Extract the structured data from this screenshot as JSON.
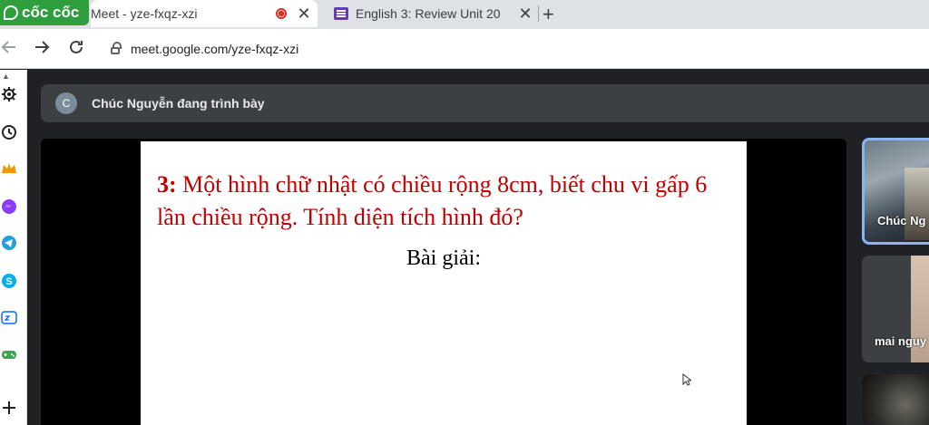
{
  "browser": {
    "brand": "cốc cốc",
    "tabs": [
      {
        "title": "Meet - yze-fxqz-xzi",
        "active": true,
        "recording": true
      },
      {
        "title": "English 3: Review Unit 20",
        "active": false
      }
    ],
    "close_glyph": "✕",
    "newtab_glyph": "+",
    "url": "meet.google.com/yze-fxqz-xzi"
  },
  "icons": {
    "back": "arrow-left-icon",
    "forward": "arrow-right-icon",
    "reload": "reload-icon",
    "lock": "lock-icon"
  },
  "sidebar": {
    "items": [
      "settings-icon",
      "history-icon",
      "crown-icon",
      "messenger-icon",
      "telegram-icon",
      "skype-icon",
      "zalo-icon",
      "game-controller-icon",
      "add-icon"
    ]
  },
  "meet": {
    "presenter_initial": "C",
    "presenting_text": "Chúc Nguyễn đang trình bày",
    "slide": {
      "number": "3:",
      "problem": "Một hình chữ nhật có chiều rộng 8cm, biết chu vi gấp 6 lần chiều rộng. Tính diện tích hình đó?",
      "solution_label": "Bài giải:"
    },
    "participants": [
      {
        "name": "Chúc Ng"
      },
      {
        "name": "mai nguy"
      },
      {
        "name": ""
      }
    ]
  },
  "colors": {
    "brand_green": "#2e9e3f",
    "slide_text_red": "#c00000",
    "active_tile_border": "#8ab4f8",
    "meet_bg": "#202124"
  }
}
